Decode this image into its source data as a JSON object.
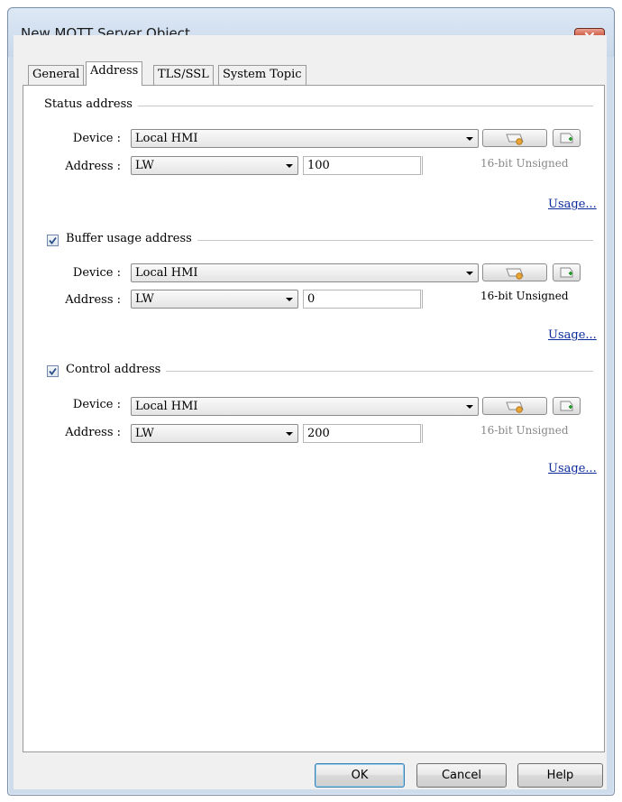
{
  "window": {
    "title": "New MQTT Server Object"
  },
  "tabs": [
    {
      "label": "General"
    },
    {
      "label": "Address"
    },
    {
      "label": "TLS/SSL"
    },
    {
      "label": "System Topic"
    }
  ],
  "groups": {
    "status": {
      "title": "Status address",
      "has_checkbox": false,
      "device_label": "Device :",
      "device_value": "Local HMI",
      "address_label": "Address :",
      "address_type": "LW",
      "address_value": "100",
      "data_type": "16-bit Unsigned",
      "usage": "Usage..."
    },
    "buffer": {
      "title": "Buffer usage address",
      "checked": true,
      "device_label": "Device :",
      "device_value": "Local HMI",
      "address_label": "Address :",
      "address_type": "LW",
      "address_value": "0",
      "data_type": "16-bit Unsigned",
      "usage": "Usage..."
    },
    "control": {
      "title": "Control address",
      "checked": true,
      "device_label": "Device :",
      "device_value": "Local HMI",
      "address_label": "Address :",
      "address_type": "LW",
      "address_value": "200",
      "data_type": "16-bit Unsigned",
      "usage": "Usage..."
    }
  },
  "buttons": {
    "ok": "OK",
    "cancel": "Cancel",
    "help": "Help"
  },
  "colors": {
    "link": "#0a2a9a",
    "close": "#c7442c",
    "frame": "#cfdcec"
  }
}
